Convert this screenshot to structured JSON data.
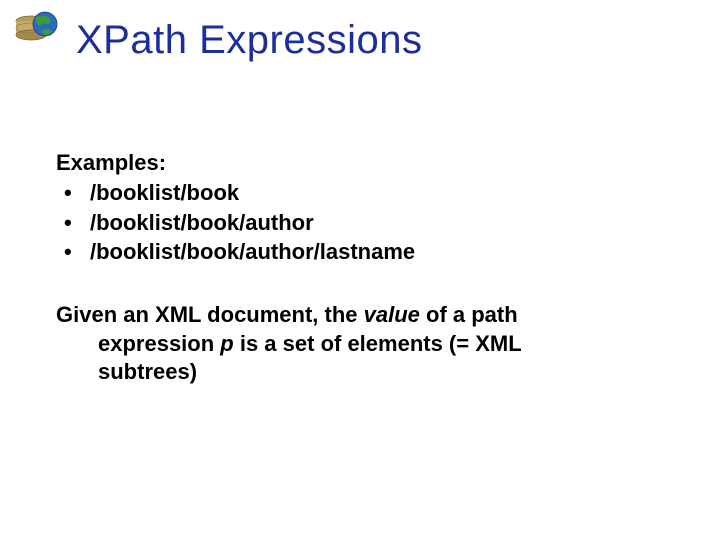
{
  "title": "XPath Expressions",
  "examples_label": "Examples:",
  "bullets": [
    "/booklist/book",
    "/booklist/book/author",
    "/booklist/book/author/lastname"
  ],
  "para": {
    "pre1": "Given an XML document, the ",
    "value_word": "value",
    "post1": " of a path",
    "line2a": "expression ",
    "p_word": "p",
    "line2b": " is a set of elements   (= XML",
    "line3": "subtrees)"
  }
}
